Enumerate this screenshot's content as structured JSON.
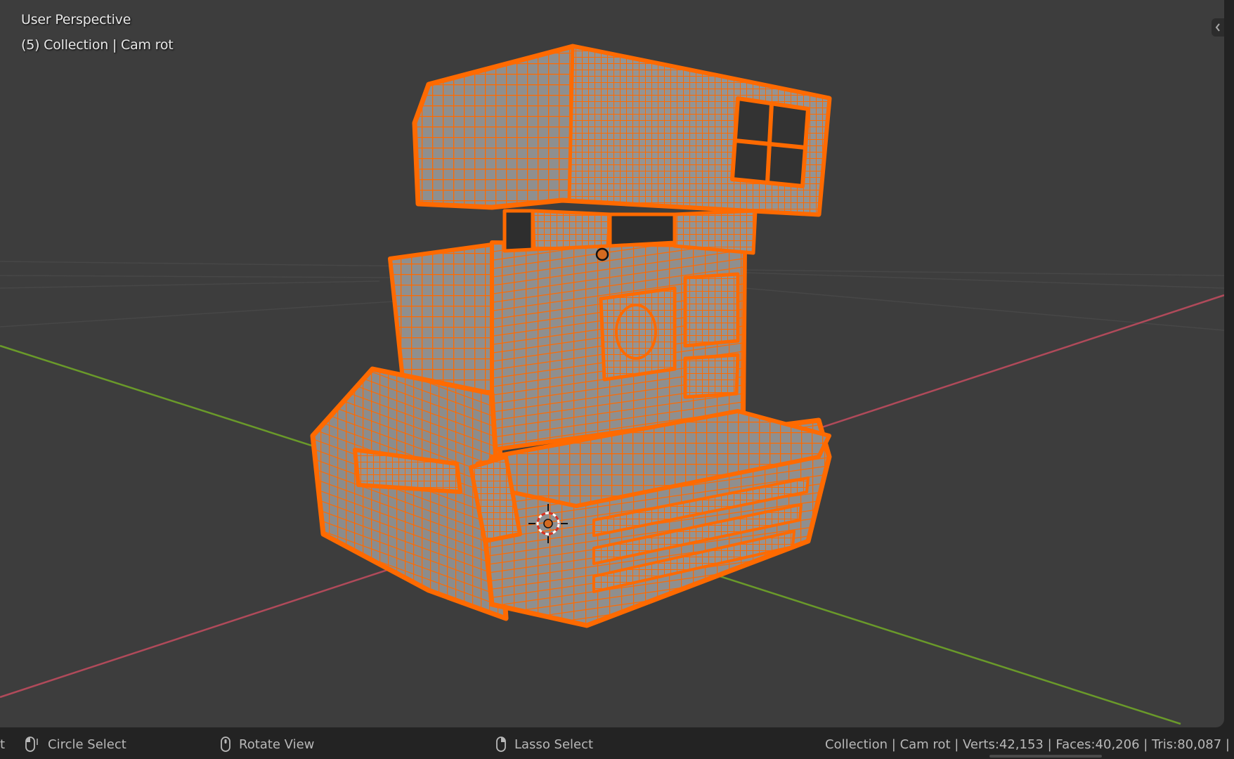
{
  "viewport": {
    "view_mode": "User Perspective",
    "collection_info": "(5) Collection | Cam rot",
    "colors": {
      "background": "#3d3d3d",
      "selection": "#ff6a00",
      "mesh_face": "#8f8f8f",
      "x_axis": "#b04a5a",
      "y_axis": "#6a9a2a",
      "grid": "#474747"
    }
  },
  "statusbar": {
    "cut_text": "t",
    "circle_select": "Circle Select",
    "rotate_view": "Rotate View",
    "lasso_select": "Lasso Select",
    "stats": "Collection | Cam rot | Verts:42,153 | Faces:40,206 | Tris:80,087 |",
    "icons": [
      "mouse-left-icon",
      "mouse-middle-icon",
      "mouse-right-icon"
    ]
  }
}
